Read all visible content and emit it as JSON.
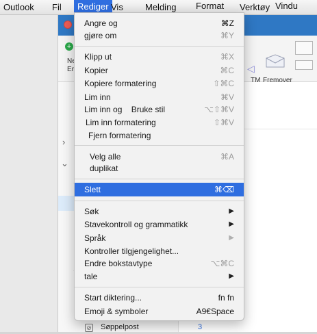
{
  "menubar": {
    "items": [
      "Outlook",
      "Fil",
      "Rediger",
      "Vis",
      "Melding",
      "Format",
      "Verktøy",
      "Vindu"
    ]
  },
  "toolbar": {
    "new_label_1": "Ne",
    "new_label_2": "Em",
    "tm_label": "TM",
    "remove_label": "Fremover"
  },
  "folders": {
    "junk_label": "Søppelpost",
    "junk_count": "3"
  },
  "edit_menu": {
    "undo": {
      "label": "Angre og",
      "shortcut": "⌘Z"
    },
    "redo": {
      "label": "gjøre om",
      "shortcut": "⌘Y"
    },
    "cut": {
      "label": "Klipp ut",
      "shortcut": "⌘X"
    },
    "copy": {
      "label": "Kopier",
      "shortcut": "⌘C"
    },
    "copy_format": {
      "label": "Kopiere formatering",
      "shortcut": "⇧⌘C"
    },
    "paste": {
      "label": "Lim inn",
      "shortcut": "⌘V"
    },
    "paste_style": {
      "label": "Lim inn og    Bruke stil",
      "shortcut": "⌥⇧⌘V"
    },
    "paste_format": {
      "label": "Lim inn formatering",
      "shortcut": "⇧⌘V"
    },
    "clear_format": {
      "label": "Fjern formatering"
    },
    "select_all": {
      "label": "Velg alle",
      "shortcut": "⌘A"
    },
    "duplicate": {
      "label": "duplikat"
    },
    "delete": {
      "label": "Slett",
      "shortcut": "⌘⌫"
    },
    "find": {
      "label": "Søk"
    },
    "spelling": {
      "label": "Stavekontroll og grammatikk"
    },
    "language": {
      "label": "Språk"
    },
    "accessibility": {
      "label": "Kontroller tilgjengelighet..."
    },
    "change_case": {
      "label": "Endre bokstavtype",
      "shortcut": "⌥⌘C"
    },
    "speech": {
      "label": "tale"
    },
    "dictation": {
      "label": "Start diktering...",
      "shortcut": "fn fn"
    },
    "emoji": {
      "label": "Emoji & symboler",
      "shortcut": "A9€Space"
    }
  },
  "colors": {
    "accent": "#2f6ee0",
    "titlebar": "#2f78c4"
  }
}
